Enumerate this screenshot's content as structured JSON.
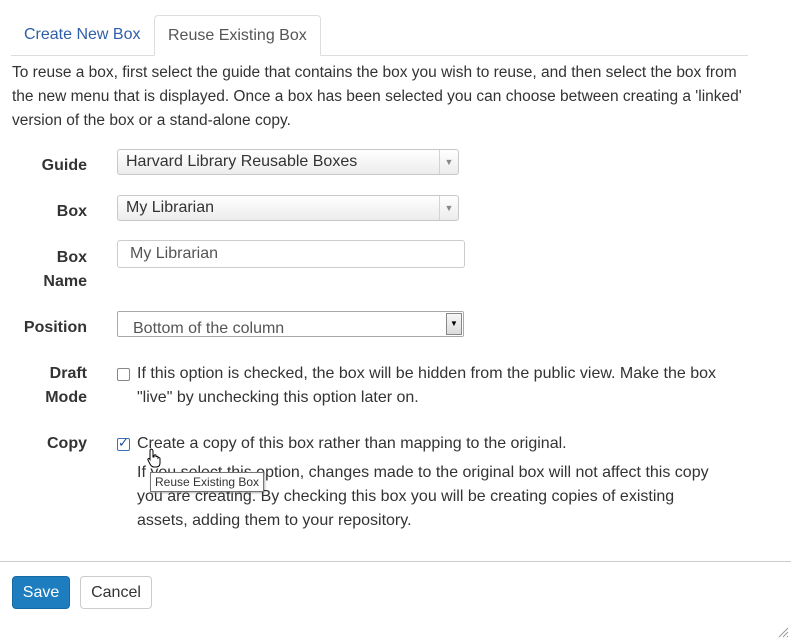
{
  "tabs": [
    {
      "label": "Create New Box",
      "active": false
    },
    {
      "label": "Reuse Existing Box",
      "active": true
    }
  ],
  "intro": "To reuse a box, first select the guide that contains the box you wish to reuse, and then select the box from the new menu that is displayed. Once a box has been selected you can choose between creating a 'linked' version of the box or a stand-alone copy.",
  "form": {
    "guide": {
      "label": "Guide",
      "value": "Harvard Library Reusable Boxes"
    },
    "box": {
      "label": "Box",
      "value": "My Librarian"
    },
    "box_name": {
      "label_line1": "Box",
      "label_line2": "Name",
      "value": "My Librarian"
    },
    "position": {
      "label": "Position",
      "value": "Bottom of the column"
    },
    "draft_mode": {
      "label_line1": "Draft",
      "label_line2": "Mode",
      "checked": false,
      "text": "If this option is checked, the box will be hidden from the public view. Make the box \"live\" by unchecking this option later on."
    },
    "copy": {
      "label": "Copy",
      "checked": true,
      "text": "Create a copy of this box rather than mapping to the original.",
      "help": "If you select this option, changes made to the original box will not affect this copy you are creating. By checking this box you will be creating copies of existing assets, adding them to your repository."
    }
  },
  "tooltip": "Reuse Existing Box",
  "buttons": {
    "save": "Save",
    "cancel": "Cancel"
  },
  "colors": {
    "accent": "#1d7dbf",
    "link": "#2f5fa8"
  }
}
